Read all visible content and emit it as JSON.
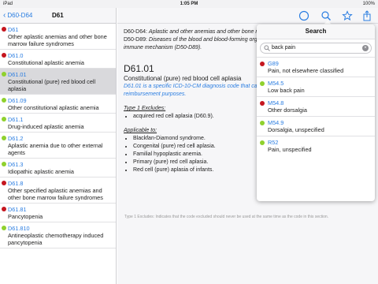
{
  "statusbar": {
    "left": "iPad",
    "time": "1:05 PM",
    "battery": "100%"
  },
  "sidebar": {
    "back_label": "D60-D64",
    "title": "D61",
    "items": [
      {
        "code": "D61",
        "desc": "Other aplastic anemias and other bone marrow failure syndromes",
        "status": "red",
        "selected": false
      },
      {
        "code": "D61.0",
        "desc": "Constitutional aplastic anemia",
        "status": "red",
        "selected": false
      },
      {
        "code": "D61.01",
        "desc": "Constitutional (pure) red blood cell aplasia",
        "status": "green",
        "selected": true
      },
      {
        "code": "D61.09",
        "desc": "Other constitutional aplastic anemia",
        "status": "green",
        "selected": false
      },
      {
        "code": "D61.1",
        "desc": "Drug-induced aplastic anemia",
        "status": "green",
        "selected": false
      },
      {
        "code": "D61.2",
        "desc": "Aplastic anemia due to other external agents",
        "status": "green",
        "selected": false
      },
      {
        "code": "D61.3",
        "desc": "Idiopathic aplastic anemia",
        "status": "green",
        "selected": false
      },
      {
        "code": "D61.8",
        "desc": "Other specified aplastic anemias and other bone marrow failure syndromes",
        "status": "red",
        "selected": false
      },
      {
        "code": "D61.81",
        "desc": "Pancytopenia",
        "status": "red",
        "selected": false
      },
      {
        "code": "D61.810",
        "desc": "Antineoplastic chemotherapy induced pancytopenia",
        "status": "green",
        "selected": false
      }
    ]
  },
  "main": {
    "crumbs": [
      {
        "code": "D60-D64",
        "text": "Aplastic and other anemias and other bone marrow failure syndromes"
      },
      {
        "code": "D50-D89",
        "text": "Diseases of the blood and blood-forming organs and certain disorders involving the immune mechanism (D50-D89)."
      }
    ],
    "code": "D61.01",
    "label": "Constitutional (pure) red blood cell aplasia",
    "billable": "D61.01 is a specific ICD-10-CM diagnosis code that can be used to indicate a diagnosis for reimbursement purposes.",
    "excludes_title": "Type 1 Excludes:",
    "excludes": [
      "acquired red cell aplasia (D60.9)."
    ],
    "applicable_title": "Applicable to:",
    "applicable": [
      "Blackfan-Diamond syndrome.",
      "Congenital (pure) red cell aplasia.",
      "Familial hypoplastic anemia.",
      "Primary (pure) red cell aplasia.",
      "Red cell (pure) aplasia of infants."
    ],
    "footnote": "Type 1 Excludes: Indicates that the code excluded should never be used at the same time as the code in this section."
  },
  "toolbar": {
    "icons": [
      "compass-icon",
      "search-icon",
      "star-icon",
      "share-icon"
    ],
    "accent": "#2a7de1"
  },
  "search": {
    "title": "Search",
    "value": "back pain",
    "results": [
      {
        "code": "G89",
        "desc": "Pain, not elsewhere classified",
        "status": "red"
      },
      {
        "code": "M54.5",
        "desc": "Low back pain",
        "status": "green"
      },
      {
        "code": "M54.8",
        "desc": "Other dorsalgia",
        "status": "red"
      },
      {
        "code": "M54.9",
        "desc": "Dorsalgia, unspecified",
        "status": "green"
      },
      {
        "code": "R52",
        "desc": "Pain, unspecified",
        "status": "green"
      }
    ]
  }
}
